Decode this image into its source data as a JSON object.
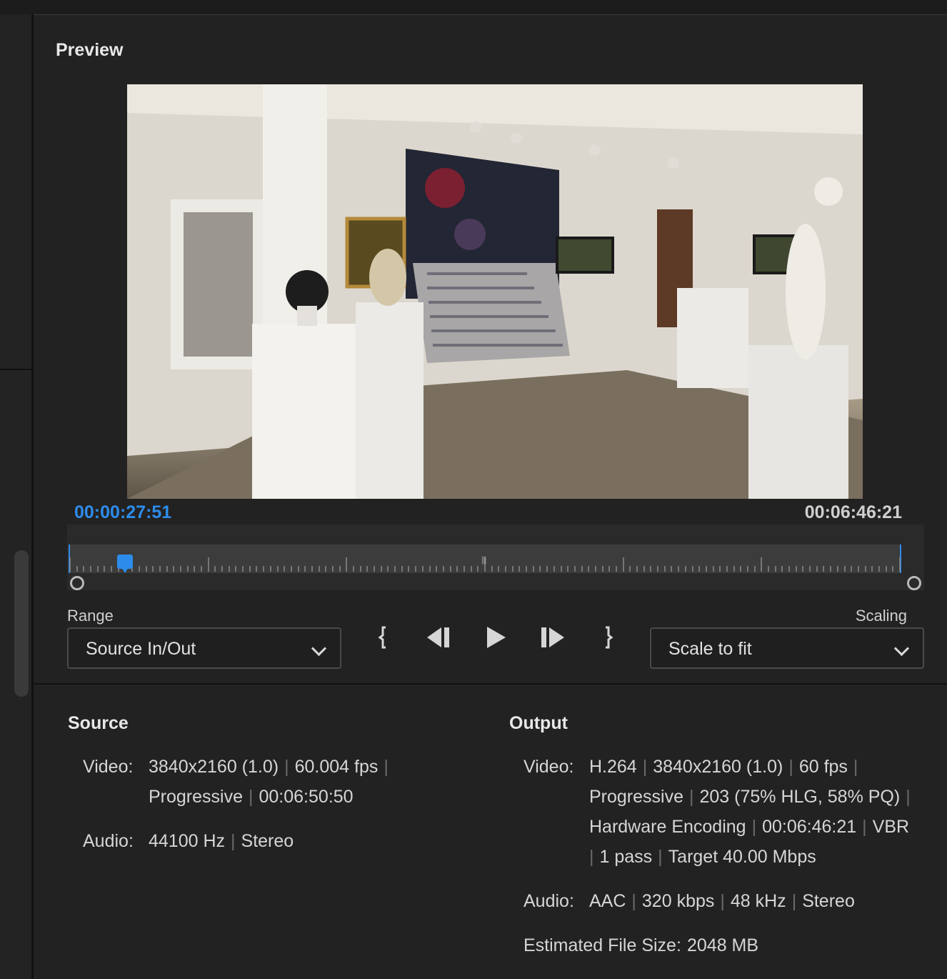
{
  "panel": {
    "title": "Preview"
  },
  "timecode": {
    "current": "00:00:27:51",
    "duration": "00:06:46:21"
  },
  "controls": {
    "range_label": "Range",
    "range_value": "Source In/Out",
    "scaling_label": "Scaling",
    "scaling_value": "Scale to fit",
    "icons": [
      "mark-in-icon",
      "step-back-icon",
      "play-icon",
      "step-forward-icon",
      "mark-out-icon"
    ]
  },
  "playhead_fraction": 0.068,
  "source": {
    "title": "Source",
    "video_key": "Video:",
    "video_line1": [
      "3840x2160 (1.0)",
      "60.004 fps"
    ],
    "video_line2": [
      "Progressive",
      "00:06:50:50"
    ],
    "audio_key": "Audio:",
    "audio": [
      "44100 Hz",
      "Stereo"
    ]
  },
  "output": {
    "title": "Output",
    "video_key": "Video:",
    "video_line1": [
      "H.264",
      "3840x2160 (1.0)",
      "60 fps"
    ],
    "video_line2": [
      "Progressive",
      "203 (75% HLG, 58% PQ)"
    ],
    "video_line3": [
      "Hardware Encoding",
      "00:06:46:21",
      "VBR"
    ],
    "video_line4": [
      "1 pass",
      "Target 40.00 Mbps"
    ],
    "audio_key": "Audio:",
    "audio": [
      "AAC",
      "320 kbps",
      "48 kHz",
      "Stereo"
    ],
    "filesize_key": "Estimated File Size:",
    "filesize": "2048 MB"
  },
  "colors": {
    "accent": "#2d8ceb",
    "background": "#222222"
  }
}
